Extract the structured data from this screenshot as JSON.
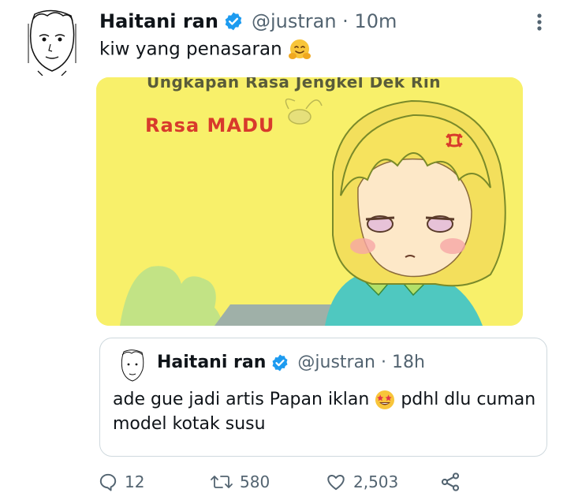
{
  "tweet": {
    "author_name": "Haitani ran",
    "handle_time": "@justran · 10m",
    "text": "kiw yang penasaran",
    "text_emoji": "hugging-face-emoji",
    "verified_color": "#1d9bf0"
  },
  "media": {
    "caption": "Ungkapan Rasa Jengkel Dek Rin",
    "subcaption": "Rasa MADU",
    "background_color": "#f8f06a"
  },
  "quote": {
    "author_name": "Haitani ran",
    "handle_time": "@justran · 18h",
    "text_before": "ade gue jadi artis Papan iklan",
    "text_after": "pdhl dlu cuman model kotak susu",
    "text_emoji": "star-struck-emoji"
  },
  "actions": {
    "replies": "12",
    "retweets": "580",
    "likes": "2,503"
  }
}
